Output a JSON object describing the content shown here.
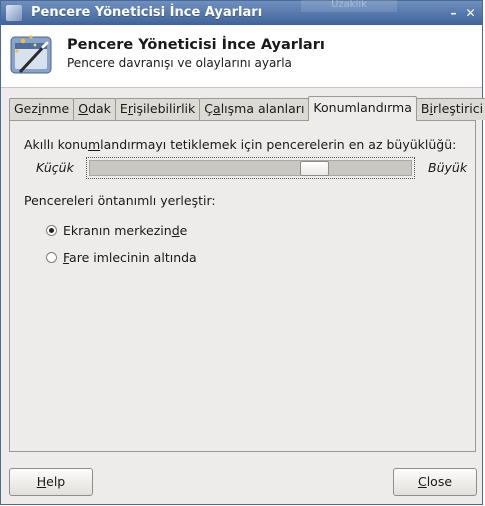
{
  "window": {
    "title": "Pencere Yöneticisi İnce Ayarları",
    "ghost_text": "Uzaklık"
  },
  "header": {
    "title": "Pencere Yöneticisi İnce Ayarları",
    "subtitle": "Pencere davranışı ve olaylarını ayarla",
    "icon": "settings-wand-icon"
  },
  "tabs": [
    {
      "label": "Gezinme",
      "mnemonic_index": 3
    },
    {
      "label": "Odak",
      "mnemonic_index": 0
    },
    {
      "label": "Erişilebilirlik",
      "mnemonic_index": 1
    },
    {
      "label": "Çalışma alanları",
      "mnemonic_index": 1
    },
    {
      "label": "Konumlandırma",
      "mnemonic_index": -1,
      "active": true
    },
    {
      "label": "Birleştirici",
      "mnemonic_index": 1
    }
  ],
  "placement": {
    "slider_label_pre": "Akıllı konu",
    "slider_label_mn": "m",
    "slider_label_post": "landırmayı tetiklemek için pencerelerin en az büyüklüğü:",
    "min_label": "Küçük",
    "max_label": "Büyük",
    "slider_value": 0.7,
    "default_label": "Pencereleri öntanımlı yerleştir:",
    "options": [
      {
        "pre": "Ekranın merkezin",
        "mn": "d",
        "post": "e",
        "checked": true
      },
      {
        "pre": "",
        "mn": "F",
        "post": "are imlecinin altında",
        "checked": false
      }
    ]
  },
  "buttons": {
    "help": {
      "mn": "H",
      "rest": "elp"
    },
    "close": {
      "mn": "C",
      "rest": "lose"
    }
  }
}
